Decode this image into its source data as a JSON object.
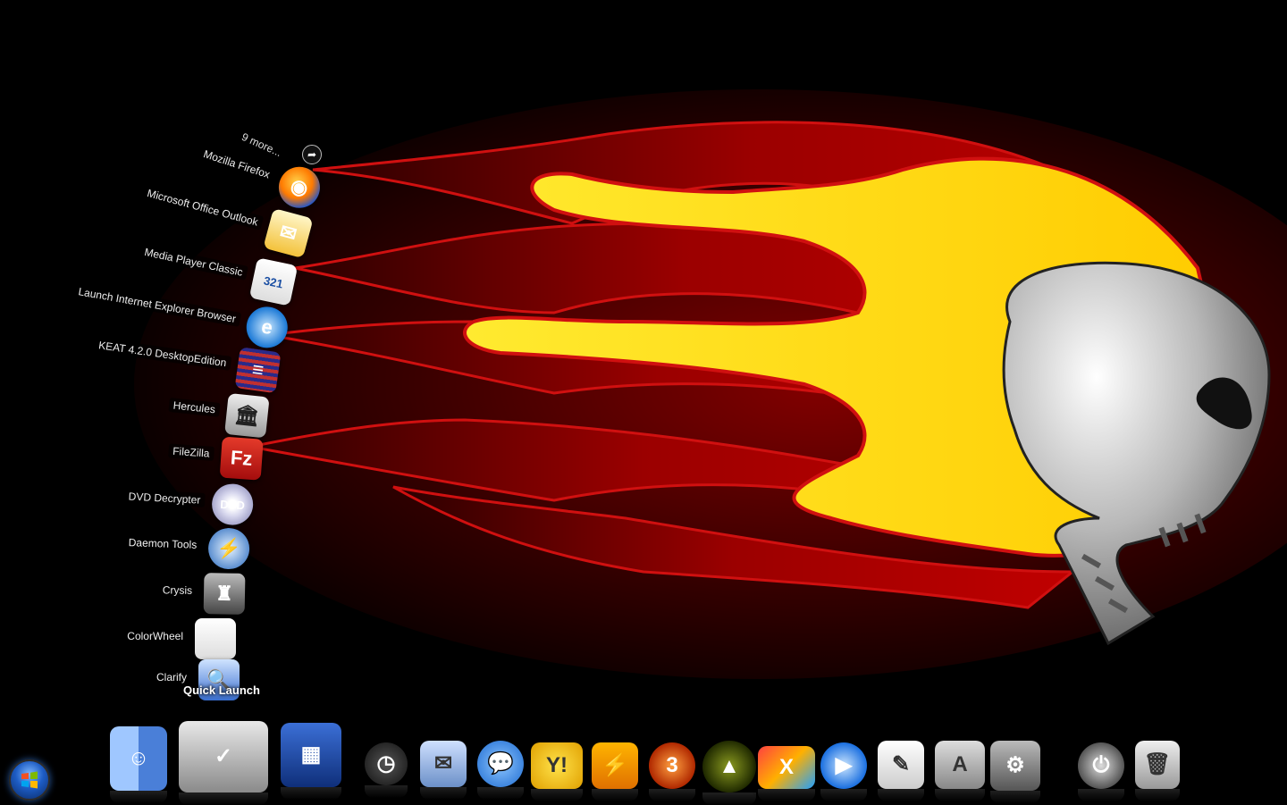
{
  "desktop": {
    "wallpaper": {
      "subject": "flaming-skull",
      "colors": {
        "background": "#000000",
        "flame_red": "#8b0000",
        "flame_yellow": "#ffd700",
        "skull": "#c0c0c0"
      }
    }
  },
  "stack": {
    "more_label": "9 more...",
    "more_icon": "arrow-icon",
    "title": "Quick Launch",
    "items": [
      {
        "label": "Mozilla Firefox",
        "icon": "firefox-icon"
      },
      {
        "label": "Microsoft Office Outlook",
        "icon": "outlook-icon"
      },
      {
        "label": "Media Player Classic",
        "icon": "media-player-classic-icon"
      },
      {
        "label": "Launch Internet Explorer Browser",
        "icon": "internet-explorer-icon"
      },
      {
        "label": "KEAT 4.2.0 DesktopEdition",
        "icon": "keat-icon"
      },
      {
        "label": "Hercules",
        "icon": "hercules-icon"
      },
      {
        "label": "FileZilla",
        "icon": "filezilla-icon"
      },
      {
        "label": "DVD Decrypter",
        "icon": "dvd-icon"
      },
      {
        "label": "Daemon Tools",
        "icon": "daemon-tools-icon"
      },
      {
        "label": "Crysis",
        "icon": "crysis-icon"
      },
      {
        "label": "ColorWheel",
        "icon": "document-icon"
      },
      {
        "label": "Clarify",
        "icon": "clarify-icon"
      }
    ]
  },
  "dock": {
    "items": [
      {
        "icon": "finder-icon"
      },
      {
        "icon": "applications-folder-icon"
      },
      {
        "icon": "spaces-icon"
      },
      {
        "icon": "dashboard-icon"
      },
      {
        "icon": "mail-icon"
      },
      {
        "icon": "ichat-icon"
      },
      {
        "icon": "yahoo-messenger-icon"
      },
      {
        "icon": "winamp-icon"
      },
      {
        "icon": "nero-icon"
      },
      {
        "icon": "alienware-icon"
      },
      {
        "icon": "x-app-icon"
      },
      {
        "icon": "media-play-icon"
      },
      {
        "icon": "text-edit-icon"
      },
      {
        "icon": "app-store-icon"
      },
      {
        "icon": "system-preferences-icon"
      },
      {
        "icon": "power-icon"
      },
      {
        "icon": "trash-icon"
      }
    ]
  },
  "taskbar": {
    "start_icon": "windows-start-orb-icon"
  }
}
